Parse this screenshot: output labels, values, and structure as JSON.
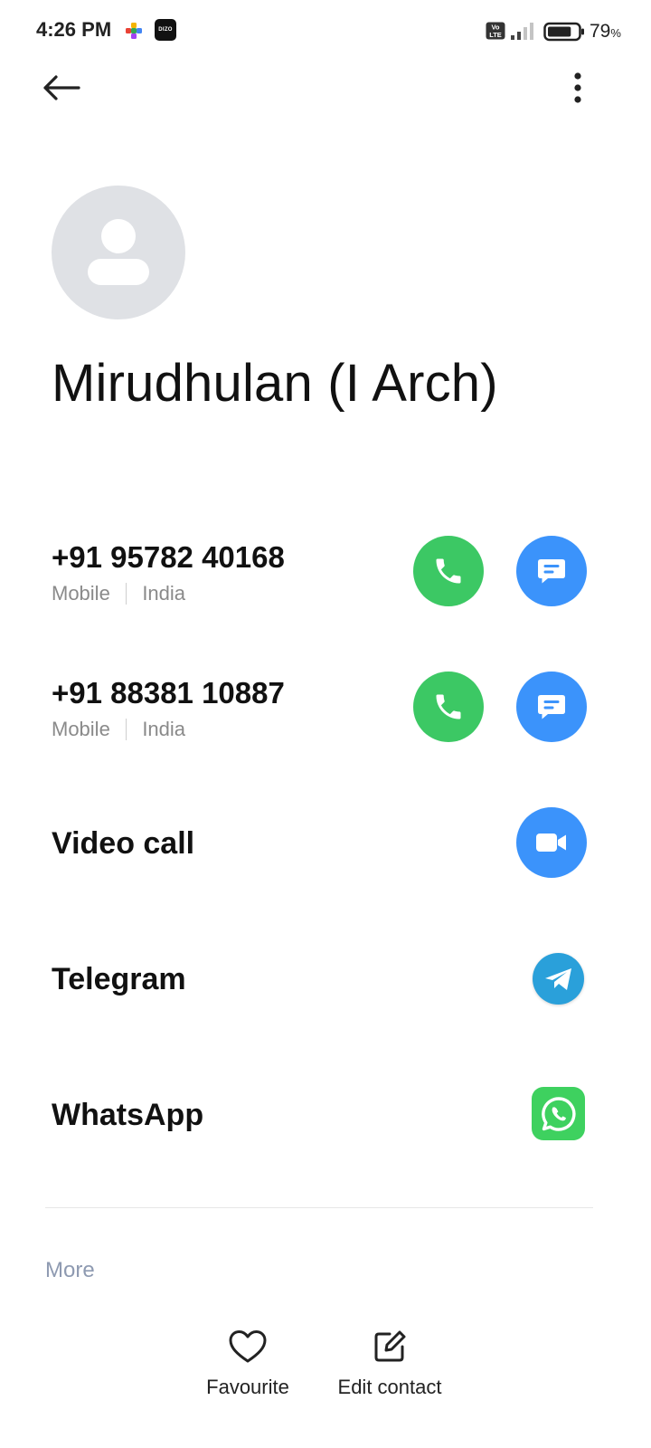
{
  "status_bar": {
    "time": "4:26 PM",
    "app_badge_text": "DIZO",
    "volte_text": "Vo LTE",
    "battery_percent": "79",
    "battery_unit": "%",
    "battery_level": 0.79
  },
  "icons": {
    "back": "arrow-left-icon",
    "overflow": "vertical-dots-icon",
    "call": "phone-icon",
    "message": "chat-bubble-icon",
    "video": "video-camera-icon",
    "telegram": "telegram-icon",
    "whatsapp": "whatsapp-icon",
    "favourite": "heart-outline-icon",
    "edit": "edit-square-icon"
  },
  "contact": {
    "name": "Mirudhulan (I Arch)"
  },
  "numbers": [
    {
      "number": "+91 95782 40168",
      "type": "Mobile",
      "region": "India"
    },
    {
      "number": "+91 88381 10887",
      "type": "Mobile",
      "region": "India"
    }
  ],
  "rows": {
    "video_call": "Video call",
    "telegram": "Telegram",
    "whatsapp": "WhatsApp"
  },
  "more_label": "More",
  "bottom_actions": {
    "favourite": "Favourite",
    "edit": "Edit contact"
  },
  "colors": {
    "call_green": "#3cc864",
    "action_blue": "#3b93fb",
    "telegram_blue": "#2aa0da",
    "whatsapp_green": "#3ed15f",
    "avatar_bg": "#dfe1e5",
    "muted_text": "#8a8a8a",
    "more_text": "#8e9ab1"
  }
}
